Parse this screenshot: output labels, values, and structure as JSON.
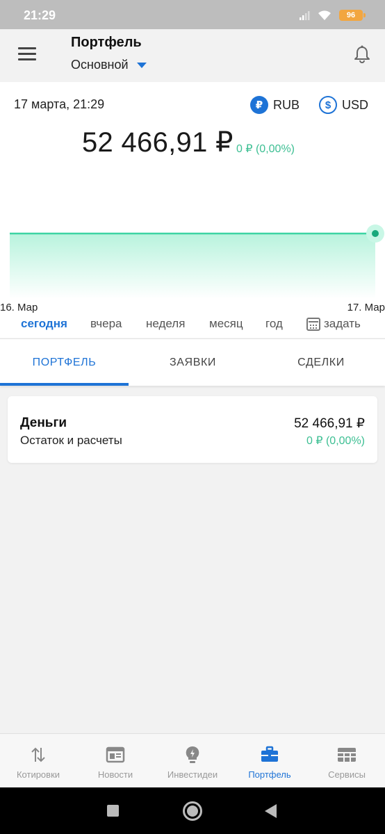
{
  "status_bar": {
    "time": "21:29",
    "battery": "96"
  },
  "header": {
    "title": "Портфель",
    "portfolio_name": "Основной"
  },
  "summary": {
    "date": "17 марта, 21:29",
    "currencies": [
      {
        "symbol": "₽",
        "label": "RUB",
        "selected": true
      },
      {
        "symbol": "$",
        "label": "USD",
        "selected": false
      }
    ],
    "total": "52 466,91 ₽",
    "change": "0 ₽ (0,00%)"
  },
  "chart_data": {
    "type": "area",
    "x": [
      "16. Мар",
      "17. Мар"
    ],
    "values": [
      52466.91,
      52466.91
    ],
    "x_tick_labels": [
      "16. Мар",
      "17. Мар"
    ],
    "title": "",
    "xlabel": "",
    "ylabel": "",
    "grid": false,
    "colors": {
      "line": "#3dd4a3",
      "fill": "#c9f7e6"
    }
  },
  "periods": {
    "items": [
      "сегодня",
      "вчера",
      "неделя",
      "месяц",
      "год"
    ],
    "active": "сегодня",
    "custom_label": "задать",
    "custom_icon": "calendar-icon"
  },
  "tabs": {
    "items": [
      "ПОРТФЕЛЬ",
      "ЗАЯВКИ",
      "СДЕЛКИ"
    ],
    "active": "ПОРТФЕЛЬ"
  },
  "cash_card": {
    "title": "Деньги",
    "subtitle": "Остаток и расчеты",
    "amount": "52 466,91 ₽",
    "change": "0 ₽ (0,00%)"
  },
  "bottom_nav": {
    "items": [
      {
        "label": "Котировки",
        "icon": "arrows-up-down-icon"
      },
      {
        "label": "Новости",
        "icon": "newspaper-icon"
      },
      {
        "label": "Инвестидеи",
        "icon": "lightbulb-icon"
      },
      {
        "label": "Портфель",
        "icon": "briefcase-icon"
      },
      {
        "label": "Сервисы",
        "icon": "grid-icon"
      }
    ],
    "active": "Портфель"
  },
  "colors": {
    "accent": "#1e73d6",
    "positive": "#3dbf93",
    "chart_line": "#3dd4a3"
  }
}
